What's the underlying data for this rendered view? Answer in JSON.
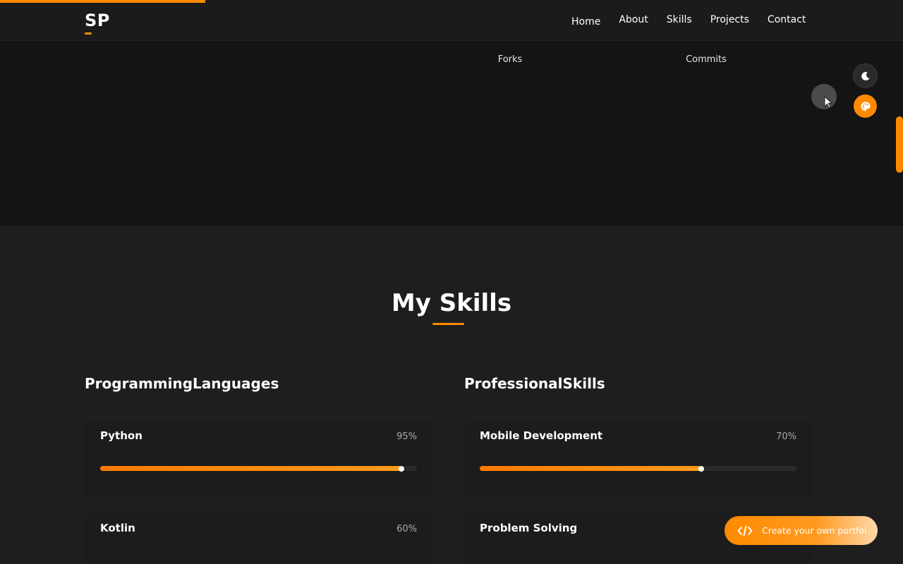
{
  "header": {
    "logo": "SP",
    "nav": [
      {
        "label": "Home"
      },
      {
        "label": "About"
      },
      {
        "label": "Skills"
      },
      {
        "label": "Projects"
      },
      {
        "label": "Contact"
      }
    ]
  },
  "stats": {
    "labels": [
      "Forks",
      "Commits"
    ]
  },
  "skills": {
    "title": "My Skills",
    "programming": {
      "title": "ProgrammingLanguages",
      "items": [
        {
          "name": "Python",
          "percent_label": "95%",
          "level": 95
        },
        {
          "name": "Kotlin",
          "percent_label": "60%",
          "level": 60
        }
      ]
    },
    "professional": {
      "title": "ProfessionalSkills",
      "items": [
        {
          "name": "Mobile Development",
          "percent_label": "70%",
          "level": 70
        },
        {
          "name": "Problem Solving",
          "percent_label": "",
          "level": null
        }
      ]
    }
  },
  "cta": {
    "label": "Create your own portfol",
    "icon": "code-icon"
  },
  "icons": {
    "theme_toggle": "moon-icon",
    "palette": "palette-icon"
  },
  "colors": {
    "accent": "#ff8a00",
    "background": "#1e1e1e"
  }
}
